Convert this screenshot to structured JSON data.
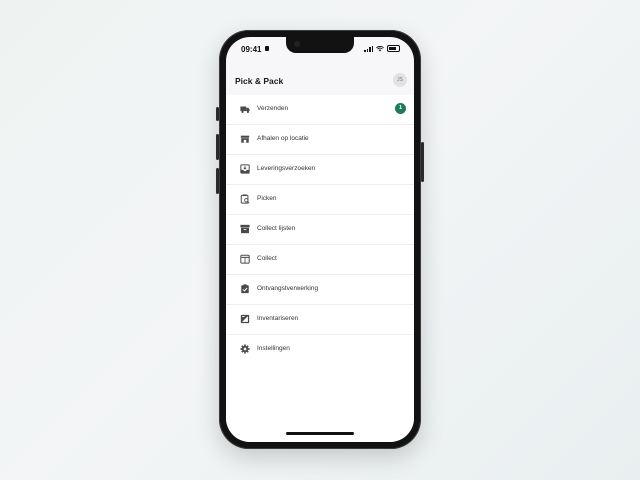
{
  "status_bar": {
    "time": "09:41"
  },
  "header": {
    "title": "Pick & Pack",
    "avatar_initials": "JS"
  },
  "menu": {
    "items": [
      {
        "label": "Verzenden",
        "icon": "truck-icon",
        "badge": "1"
      },
      {
        "label": "Afhalen op locatie",
        "icon": "store-icon"
      },
      {
        "label": "Leveringsverzoeken",
        "icon": "inbox-icon"
      },
      {
        "label": "Picken",
        "icon": "clipboard-search-icon"
      },
      {
        "label": "Collect lijsten",
        "icon": "archive-icon"
      },
      {
        "label": "Collect",
        "icon": "calendar-box-icon"
      },
      {
        "label": "Ontvangstverwerking",
        "icon": "clipboard-check-icon"
      },
      {
        "label": "Inventariseren",
        "icon": "inventory-icon"
      },
      {
        "label": "Instellingen",
        "icon": "gear-icon"
      }
    ]
  },
  "colors": {
    "badge": "#1f7a5a",
    "icon": "#4a4a4a",
    "screen_bg": "#f7f6f8"
  }
}
